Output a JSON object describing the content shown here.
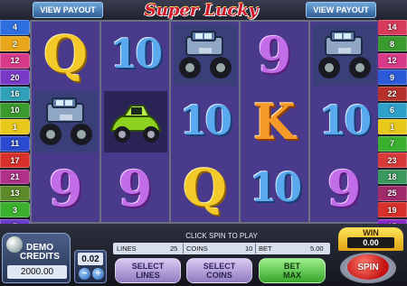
{
  "header": {
    "logo_text": "Super Lucky",
    "view_payout_left": "VIEW PAYOUT",
    "view_payout_right": "VIEW PAYOUT"
  },
  "paylines": {
    "left": [
      {
        "label": "4",
        "color": "#2d6fe0"
      },
      {
        "label": "2",
        "color": "#e8a61a"
      },
      {
        "label": "12",
        "color": "#d83a8a"
      },
      {
        "label": "20",
        "color": "#7a3ac8"
      },
      {
        "label": "16",
        "color": "#2fa0b8"
      },
      {
        "label": "10",
        "color": "#3a9a2e"
      },
      {
        "label": "1",
        "color": "#e8c81a"
      },
      {
        "label": "11",
        "color": "#2a4ad0"
      },
      {
        "label": "17",
        "color": "#d8302a"
      },
      {
        "label": "21",
        "color": "#b0308a"
      },
      {
        "label": "13",
        "color": "#5a8a2a"
      },
      {
        "label": "3",
        "color": "#3ab02e"
      },
      {
        "label": "5",
        "color": "#6a3ac8"
      }
    ],
    "right": [
      {
        "label": "14",
        "color": "#d83a5a"
      },
      {
        "label": "8",
        "color": "#3a9a2e"
      },
      {
        "label": "12",
        "color": "#d83a8a"
      },
      {
        "label": "9",
        "color": "#2a5ad8"
      },
      {
        "label": "22",
        "color": "#b8302a"
      },
      {
        "label": "6",
        "color": "#2fa0c8"
      },
      {
        "label": "1",
        "color": "#e8c81a"
      },
      {
        "label": "7",
        "color": "#3ab02e"
      },
      {
        "label": "23",
        "color": "#d83a3a"
      },
      {
        "label": "18",
        "color": "#3a9a5e"
      },
      {
        "label": "25",
        "color": "#a02a6a"
      },
      {
        "label": "19",
        "color": "#d8302a"
      },
      {
        "label": "15",
        "color": "#8a2ac8"
      }
    ]
  },
  "reels": [
    [
      "Q",
      "truck",
      "9"
    ],
    [
      "10",
      "car",
      "9"
    ],
    [
      "truck",
      "10",
      "Q"
    ],
    [
      "9",
      "K",
      "10"
    ],
    [
      "truck",
      "10",
      "9"
    ]
  ],
  "console": {
    "demo_credits_label": "DEMO\nCREDITS",
    "credits_value": "2000.00",
    "denomination": "0.02",
    "denom_minus": "−",
    "denom_plus": "+",
    "message": "CLICK SPIN TO PLAY",
    "lines_label": "LINES",
    "lines_value": "25",
    "coins_label": "COINS",
    "coins_value": "10",
    "bet_label": "BET",
    "bet_value": "5.00",
    "select_lines": "SELECT\nLINES",
    "select_coins": "SELECT\nCOINS",
    "bet_max": "BET\nMAX",
    "win_label": "WIN",
    "win_value": "0.00",
    "spin_label": "SPIN"
  },
  "colors": {
    "reel_bg": "#4a3a8c",
    "nine": "#c26de8",
    "ten": "#5aa8ee",
    "queen": "#f4c92a",
    "king": "#f59a28",
    "spin": "#c41210",
    "bet_max": "#36a428"
  }
}
